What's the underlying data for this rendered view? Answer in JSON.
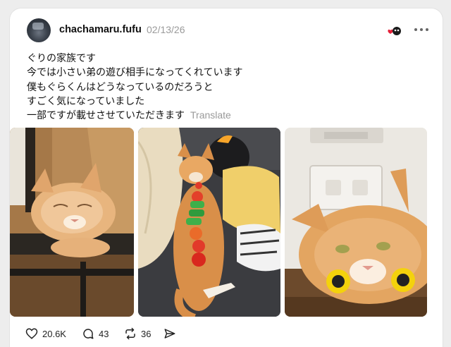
{
  "post": {
    "username": "chachamaru.fufu",
    "date": "02/13/26",
    "text_lines": [
      "ぐりの家族です",
      "今では小さい弟の遊び相手になってくれています",
      "僕もぐらくんはどうなっているのだろうと",
      "すごく気になっていました",
      "一部ですが載せさせていただきます"
    ],
    "translate_label": "Translate"
  },
  "images": [
    {
      "name": "cat-on-stairs-photo"
    },
    {
      "name": "cat-with-toddler-photo"
    },
    {
      "name": "cat-with-wheels-photo"
    }
  ],
  "actions": {
    "likes": "20.6K",
    "replies": "43",
    "reposts": "36"
  },
  "colors": {
    "badge_red": "#e5213a",
    "text_muted": "#999999",
    "card_bg": "#ffffff"
  },
  "icons": [
    "heart-icon",
    "comment-icon",
    "repost-icon",
    "share-icon",
    "more-icon",
    "profile-badge-icon"
  ]
}
